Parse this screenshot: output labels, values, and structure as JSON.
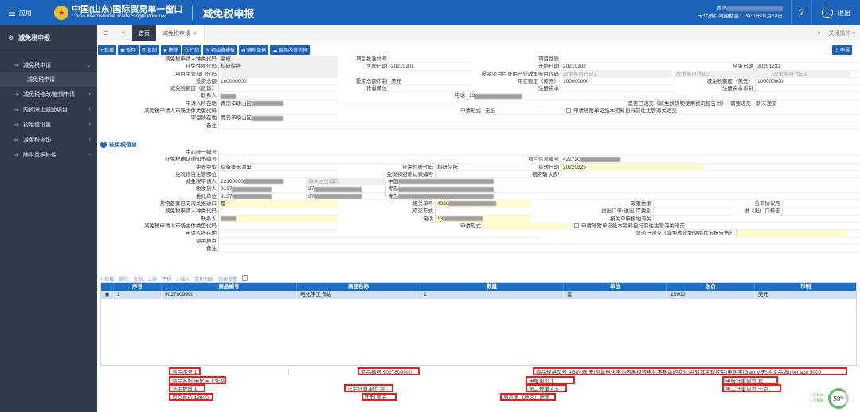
{
  "topbar": {
    "menu_label": "应用",
    "brand_cn": "中国(山东)国际贸易单一窗口",
    "brand_en": "China International Trade Single Window",
    "page_title": "减免税申报",
    "user_line1_prefix": "青岛",
    "user_line2": "卡介质有效期截至：2031年01月14日",
    "logout_label": "退出"
  },
  "sidebar": {
    "header": "减免税申报",
    "items": [
      {
        "label": "减免税申请",
        "expanded": true
      },
      {
        "label": "减免税申请",
        "sub": true
      },
      {
        "label": "减免税修改/撤销申请"
      },
      {
        "label": "内资限上鼓励项目"
      },
      {
        "label": "初始值设置"
      },
      {
        "label": "减免税查询"
      },
      {
        "label": "随附单据补传"
      }
    ]
  },
  "tabs": {
    "home": "首页",
    "current": "减免税申请",
    "close_ops": "关闭操作"
  },
  "toolbar": {
    "new": "新增",
    "save": "暂存",
    "copy": "复制",
    "delete": "删除",
    "print": "打印",
    "init_template": "初始值模板",
    "attach": "随附单据",
    "fetch": "调用内资信息",
    "declare": "申报"
  },
  "form": {
    "rows": [
      [
        {
          "l": "减免税申请人种类代码",
          "v": "高校"
        },
        {
          "l": "项目批准文号",
          "v": ""
        },
        {
          "l": "项目性质",
          "v": ""
        }
      ],
      [
        {
          "l": "征免性质代码",
          "v": "科研院所"
        },
        {
          "l": "立项日期",
          "v": "20210101"
        },
        {
          "l": "开始日期",
          "v": "20210102"
        },
        {
          "l": "结束日期",
          "v": "20251231"
        }
      ],
      [
        {
          "l": "项目主管部门代码",
          "v": ""
        },
        {
          "l": "投资项目目录用产业政策条目代码",
          "v": "政策条目代码1"
        },
        {
          "l": "",
          "v": "政策条目代码2"
        },
        {
          "l": "",
          "v": "政策条目代码3"
        }
      ],
      [
        {
          "l": "投资总额",
          "v": "100000000"
        },
        {
          "l": "投资总额币制",
          "v": "美元"
        },
        {
          "l": "用汇额度（美元）",
          "v": "100000000"
        },
        {
          "l": "减免税额度（美元）",
          "v": "100000000"
        }
      ],
      [
        {
          "l": "减免税额度（数量）",
          "v": ""
        },
        {
          "l": "计量单位",
          "v": ""
        },
        {
          "l": "注册资本",
          "v": ""
        },
        {
          "l": "注册资本币制",
          "v": ""
        }
      ],
      [
        {
          "l": "联系人",
          "v": ""
        },
        {
          "l": "电话",
          "v": "13"
        }
      ],
      [
        {
          "l": "申请人所在地",
          "v": "青岛市崂山区"
        },
        {
          "l": "是否已递交《减免税货物使用状况报告书》",
          "v": "需要递交，暂未递交"
        }
      ],
      [
        {
          "l": "减免税申请人市场主体类型代码",
          "v": ""
        },
        {
          "l": "申请形式",
          "v": "无纸"
        },
        {
          "l": "申请随附单证纸本资料自行前往主管海关递交",
          "v": ""
        }
      ],
      [
        {
          "l": "项目所在地",
          "v": "青岛市崂山区"
        }
      ],
      [
        {
          "l": "备注",
          "v": ""
        }
      ]
    ]
  },
  "section": {
    "title": "征免税信息"
  },
  "form2": {
    "rows": [
      [
        {
          "l": "中心统一编号",
          "v": ""
        }
      ],
      [
        {
          "l": "征免税确认通知书编号",
          "v": ""
        },
        {
          "l": "项目信息编号",
          "v": "422720"
        }
      ],
      [
        {
          "l": "免表类型",
          "v": "有备案无清单"
        },
        {
          "l": "征免性质代码",
          "v": "科研院所"
        },
        {
          "l": "有效日期",
          "v": "20220825"
        }
      ],
      [
        {
          "l": "免税物资主管部位",
          "v": ""
        },
        {
          "l": "免税物资确认表编号",
          "v": ""
        },
        {
          "l": "物资确认表有效期",
          "v": ""
        }
      ],
      [
        {
          "l": "减免税申请人",
          "v": "12100000"
        },
        {
          "l": "海关注册编码",
          "v": ""
        },
        {
          "l": "中国",
          "v": ""
        }
      ],
      [
        {
          "l": "收发货人",
          "v": "9137"
        },
        {
          "l": "37",
          "v": ""
        },
        {
          "l": "青岛",
          "v": ""
        }
      ],
      [
        {
          "l": "委托单位",
          "v": "9137"
        },
        {
          "l": "37",
          "v": ""
        },
        {
          "l": "青岛",
          "v": ""
        }
      ],
      [
        {
          "l": "货物备案已向海关报进口",
          "v": "是"
        },
        {
          "l": "报关单号",
          "v": "4220"
        },
        {
          "l": "政策依据",
          "v": ""
        },
        {
          "l": "合同协议号",
          "v": ""
        }
      ],
      [
        {
          "l": "减免税申请人种类代码",
          "v": ""
        },
        {
          "l": "成交方式",
          "v": ""
        },
        {
          "l": "进出口单(进出)岸类别",
          "v": ""
        },
        {
          "l": "进（出）口标志",
          "v": ""
        }
      ],
      [
        {
          "l": "联系人",
          "v": ""
        },
        {
          "l": "电话",
          "v": "13"
        },
        {
          "l": "报关单申报地海关",
          "v": ""
        }
      ],
      [
        {
          "l": "减免税申请人市场主体类型代码",
          "v": ""
        },
        {
          "l": "申请形式",
          "v": ""
        },
        {
          "l": "申请随附单证纸本资料自行前往主管海关递交",
          "v": ""
        }
      ],
      [
        {
          "l": "申请人所在地",
          "v": ""
        },
        {
          "l": "是否已递交《减免税货物使用状况报告书》",
          "v": ""
        }
      ],
      [
        {
          "l": "使用地点",
          "v": ""
        }
      ],
      [
        {
          "l": "备注",
          "v": ""
        }
      ]
    ]
  },
  "grid_toolbar": [
    "+ 新增",
    "删除",
    "复制",
    "上移",
    "下移",
    "1 插入",
    "重新归类",
    "归类查看"
  ],
  "grid": {
    "columns": [
      "序号",
      "商品编号",
      "商品名称",
      "数量",
      "单位",
      "总价",
      "币制"
    ],
    "rows": [
      [
        "1",
        "9027809990",
        "电化学工作站",
        "1",
        "套",
        "13900",
        "美元"
      ]
    ]
  },
  "detail": {
    "seq": "商品序号 1",
    "code": "商品编号 9027809990",
    "spec": "商品规格型号 4|3|仪器|无|测量电化学池内电极等电化学参数的变化|并对其实现控制|电化学|Gamry|无|中文品牌Interface 5000",
    "name": "商品名称 电化学工作站",
    "price": "申报单价 1",
    "tax": "申报计量单位 套",
    "qty": "法定数量 1",
    "unit": "法定计量单位 台",
    "qty2": "第二数量 4.5",
    "unit2": "第二计量单位 千克",
    "total": "成交总价 13900",
    "currency": "币制 美元",
    "origin": "原产国（地区）德国"
  },
  "meter": {
    "percent": "53",
    "unit": "%",
    "up": "0 K/s",
    "down": "0 K/s"
  }
}
